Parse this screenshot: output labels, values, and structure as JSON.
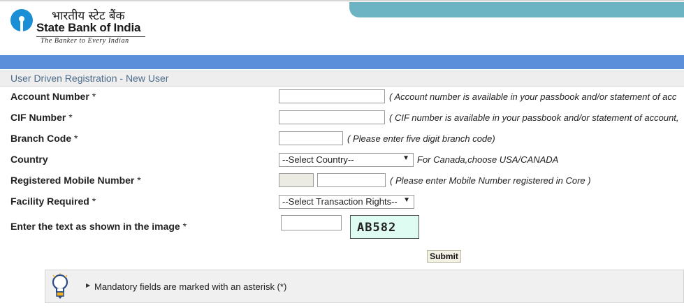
{
  "brand": {
    "hindi_name": "भारतीय स्टेट बैंक",
    "name": "State Bank of India",
    "tagline": "The Banker to Every Indian",
    "colors": {
      "header_tab": "#6cb3c4",
      "blue_bar": "#5b8fd9",
      "section_title_text": "#4b6b8a",
      "captcha_bg": "#dffcf2"
    }
  },
  "section": {
    "title": "User Driven Registration - New User"
  },
  "form": {
    "account_number": {
      "label": "Account Number",
      "required": "*",
      "value": "",
      "hint": "( Account number is available in your passbook and/or statement of acc"
    },
    "cif_number": {
      "label": "CIF Number",
      "required": "*",
      "value": "",
      "hint": "( CIF number is available in your passbook and/or statement of account,"
    },
    "branch_code": {
      "label": "Branch Code",
      "required": "*",
      "value": "",
      "hint": "( Please enter five digit branch code)"
    },
    "country": {
      "label": "Country",
      "selected": "--Select Country--",
      "hint": "For Canada,choose USA/CANADA"
    },
    "mobile": {
      "label": "Registered Mobile Number",
      "required": "*",
      "code_value": "",
      "value": "",
      "hint": "( Please enter Mobile Number registered in Core )"
    },
    "facility": {
      "label": "Facility Required",
      "required": "*",
      "selected": "--Select Transaction Rights--"
    },
    "captcha": {
      "label": "Enter the text as shown in the image",
      "required": "*",
      "value": "",
      "image_text": "AB582"
    },
    "submit_label": "Submit"
  },
  "note": {
    "text": "Mandatory fields are marked with an asterisk (*)"
  }
}
